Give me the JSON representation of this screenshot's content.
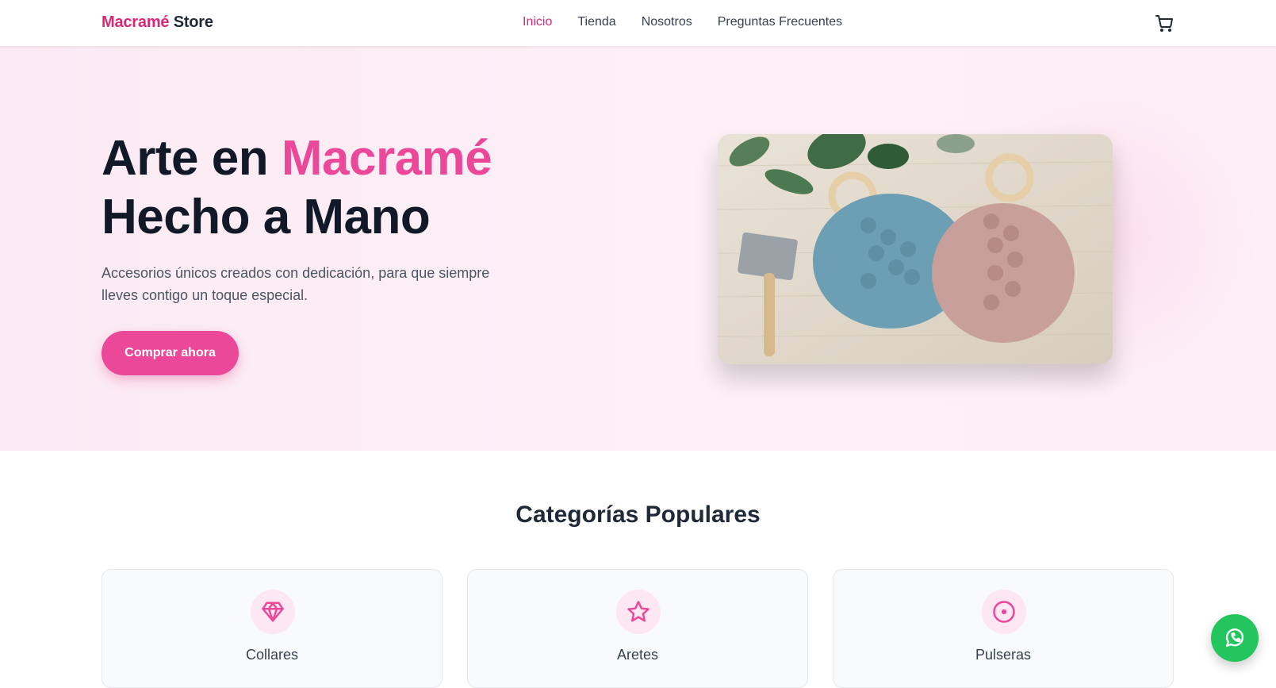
{
  "brand": {
    "part1": "Macramé",
    "part2": "Store"
  },
  "nav": {
    "items": [
      {
        "label": "Inicio",
        "active": true
      },
      {
        "label": "Tienda",
        "active": false
      },
      {
        "label": "Nosotros",
        "active": false
      },
      {
        "label": "Preguntas Frecuentes",
        "active": false
      }
    ]
  },
  "icons": {
    "cart": "cart-icon",
    "whatsapp": "whatsapp-icon"
  },
  "hero": {
    "title_line1_a": "Arte en",
    "title_line1_b": "Macramé",
    "title_line2": "Hecho a Mano",
    "subtitle": "Accesorios únicos creados con dedicación, para que siempre lleves contigo un toque especial.",
    "cta_label": "Comprar ahora"
  },
  "categories": {
    "title": "Categorías Populares",
    "items": [
      {
        "label": "Collares",
        "icon": "gem-icon"
      },
      {
        "label": "Aretes",
        "icon": "star-icon"
      },
      {
        "label": "Pulseras",
        "icon": "circle-dot-icon"
      }
    ]
  },
  "colors": {
    "accent": "#ec4899",
    "brand_pink": "#db2777",
    "hero_bg": "#fdf1f7",
    "whatsapp": "#22c55e"
  }
}
